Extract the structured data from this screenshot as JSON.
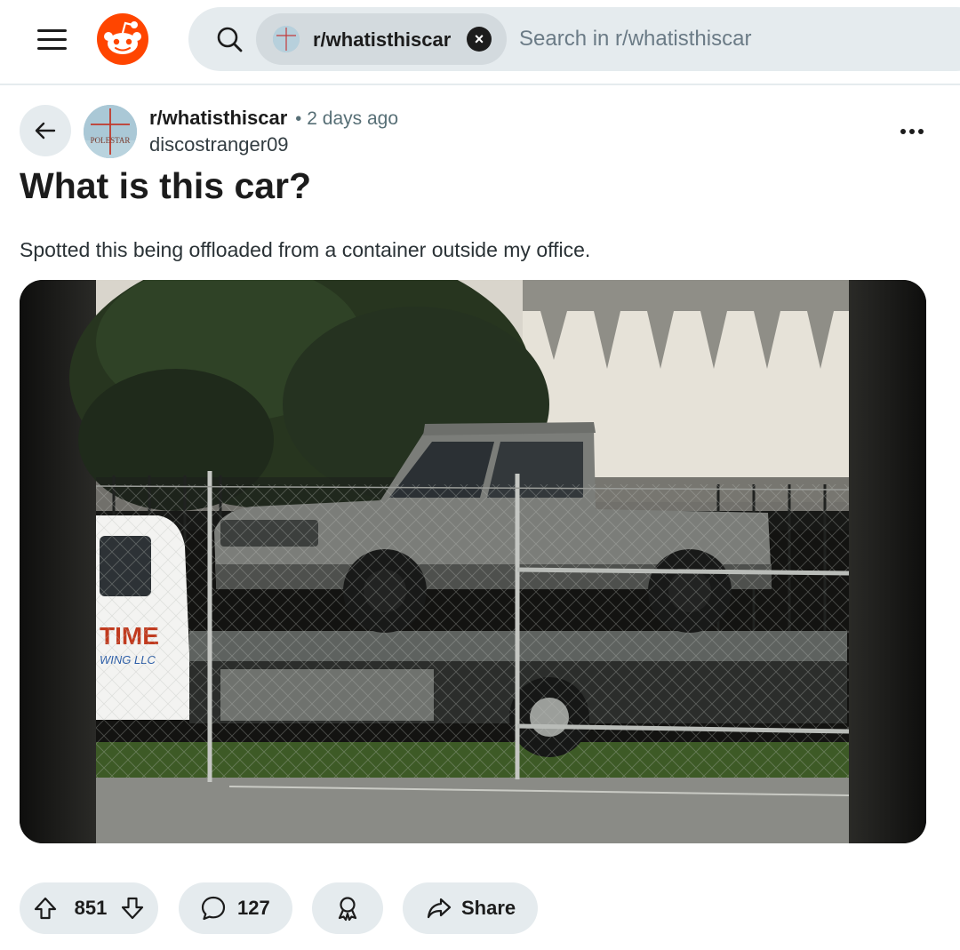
{
  "header": {
    "menu_icon": "hamburger-menu-icon",
    "logo_icon": "reddit-logo-icon",
    "brand_color": "#ff4500",
    "search": {
      "icon": "search-icon",
      "scope_chip": "r/whatisthiscar",
      "clear_icon": "close-icon",
      "placeholder": "Search in r/whatisthiscar",
      "value": ""
    }
  },
  "post": {
    "back_icon": "arrow-left-icon",
    "subreddit": "r/whatisthiscar",
    "separator": "•",
    "time_ago": "2 days ago",
    "author": "discostranger09",
    "avatar_text": "POLESTAR",
    "more_icon": "more-horizontal-icon",
    "title": "What is this car?",
    "body": "Spotted this being offloaded from a container outside my office.",
    "media_alt": "Grey pickup truck on a flatbed tow truck behind a chain-link fence"
  },
  "actions": {
    "upvote_icon": "arrow-up-icon",
    "score": "851",
    "downvote_icon": "arrow-down-icon",
    "comment_icon": "comment-bubble-icon",
    "comments": "127",
    "award_icon": "award-icon",
    "share_icon": "share-arrow-icon",
    "share_label": "Share",
    "pill_color": "#e5ebee"
  }
}
